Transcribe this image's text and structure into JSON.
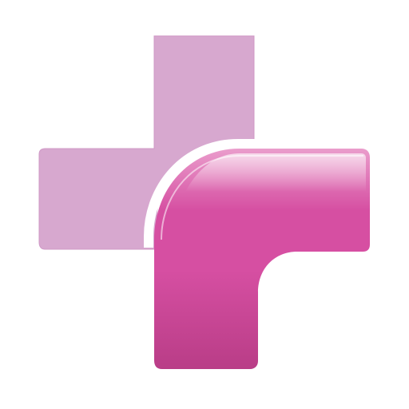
{
  "icon": {
    "name": "medical-cross-icon",
    "colors": {
      "background": "#ffffff",
      "light_cross": "#d7a8cf",
      "light_cross_edge": "#cf98c6",
      "front_main": "#d64fa2",
      "front_top": "#ea9dcc",
      "front_highlight": "#ffffff",
      "front_shadow": "#b93d87"
    }
  }
}
